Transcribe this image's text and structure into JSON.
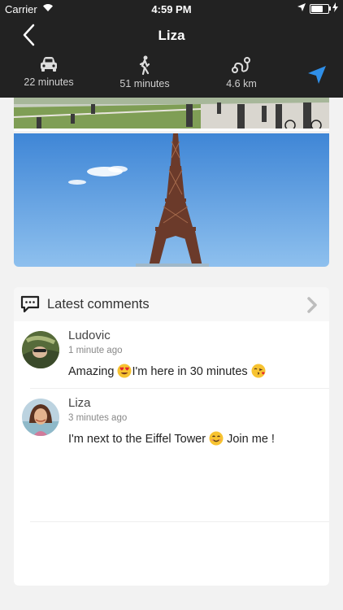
{
  "status_bar": {
    "carrier": "Carrier",
    "time": "4:59 PM",
    "battery_level": 0.75
  },
  "nav": {
    "title": "Liza"
  },
  "transport": {
    "modes": [
      {
        "icon": "car-icon",
        "label": "22 minutes"
      },
      {
        "icon": "walking-icon",
        "label": "51 minutes"
      },
      {
        "icon": "route-distance-icon",
        "label": "4.6 km"
      }
    ]
  },
  "comments_section": {
    "title": "Latest comments",
    "comments": [
      {
        "author": "Ludovic",
        "time": "1 minute ago",
        "text_before": "Amazing ",
        "text_after": "I'm here in 30 minutes ",
        "emojis": [
          "heart-eyes-emoji",
          "kissing-heart-emoji"
        ]
      },
      {
        "author": "Liza",
        "time": "3 minutes ago",
        "text_before": "I'm next to the Eiffel Tower ",
        "text_after": " Join me !",
        "emojis": [
          "smile-emoji"
        ]
      }
    ]
  },
  "colors": {
    "bar": "#222222",
    "accent": "#2f8fe8",
    "background": "#f2f2f2"
  }
}
